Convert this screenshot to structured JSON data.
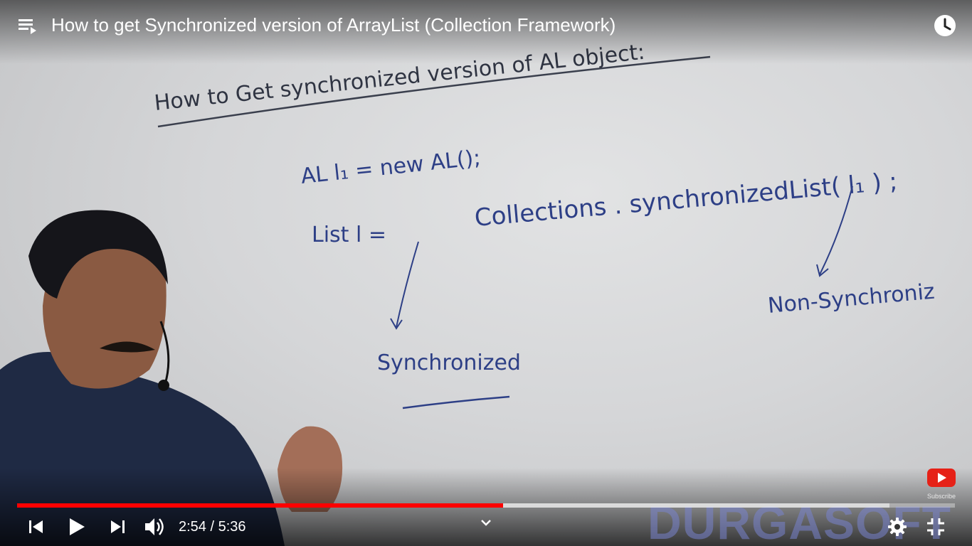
{
  "header": {
    "title": "How to get Synchronized version of ArrayList (Collection Framework)"
  },
  "whiteboard": {
    "heading": "How to Get synchronized version of AL object:",
    "line1": "AL    l₁ = new   AL();",
    "line2_lhs": "List    l  =",
    "line2_rhs": "Collections . synchronizedList( l₁ ) ;",
    "note_left": "Synchronized",
    "note_right": "Non-Synchroniz"
  },
  "overlay": {
    "subscribe_label": "Subscribe",
    "watermark": "DURGASOFT"
  },
  "player": {
    "current_time": "2:54",
    "duration": "5:36",
    "time_display": "2:54 / 5:36",
    "progress_played_fraction": 0.518,
    "progress_buffered_fraction": 0.93,
    "accent_color": "#ff0000"
  },
  "icons": {
    "playlist": "playlist-icon",
    "watch_later": "clock-icon",
    "previous": "skip-previous-icon",
    "play": "play-icon",
    "next": "skip-next-icon",
    "volume": "volume-icon",
    "chapters": "chevron-down-icon",
    "settings": "gear-icon",
    "exit_fullscreen": "exit-fullscreen-icon",
    "subscribe": "youtube-logo-icon"
  }
}
